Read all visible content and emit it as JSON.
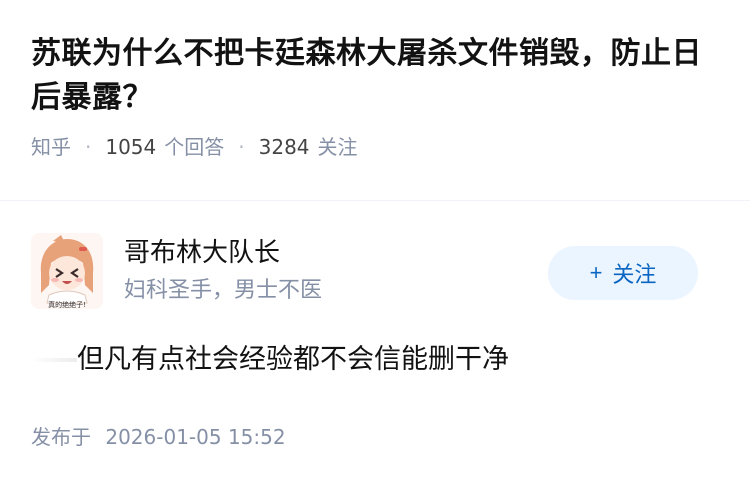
{
  "question": {
    "title": "苏联为什么不把卡廷森林大屠杀文件销毁，防止日后暴露？",
    "source": "知乎",
    "answer_count": "1054",
    "answer_unit": "个回答",
    "follower_count": "3284",
    "follower_unit": "关注"
  },
  "author": {
    "name": "哥布林大队长",
    "bio": "妇科圣手，男士不医",
    "avatar_caption": "真的绝绝子!",
    "follow_label": "关注",
    "follow_icon": "plus-icon"
  },
  "answer": {
    "text": "但凡有点社会经验都不会信能删干净"
  },
  "publish": {
    "label": "发布于",
    "time": "2026-01-05 15:52"
  },
  "colors": {
    "text": "#121212",
    "meta": "#8590a6",
    "follow_bg": "#ebf5ff",
    "follow_text": "#0a66c2"
  }
}
